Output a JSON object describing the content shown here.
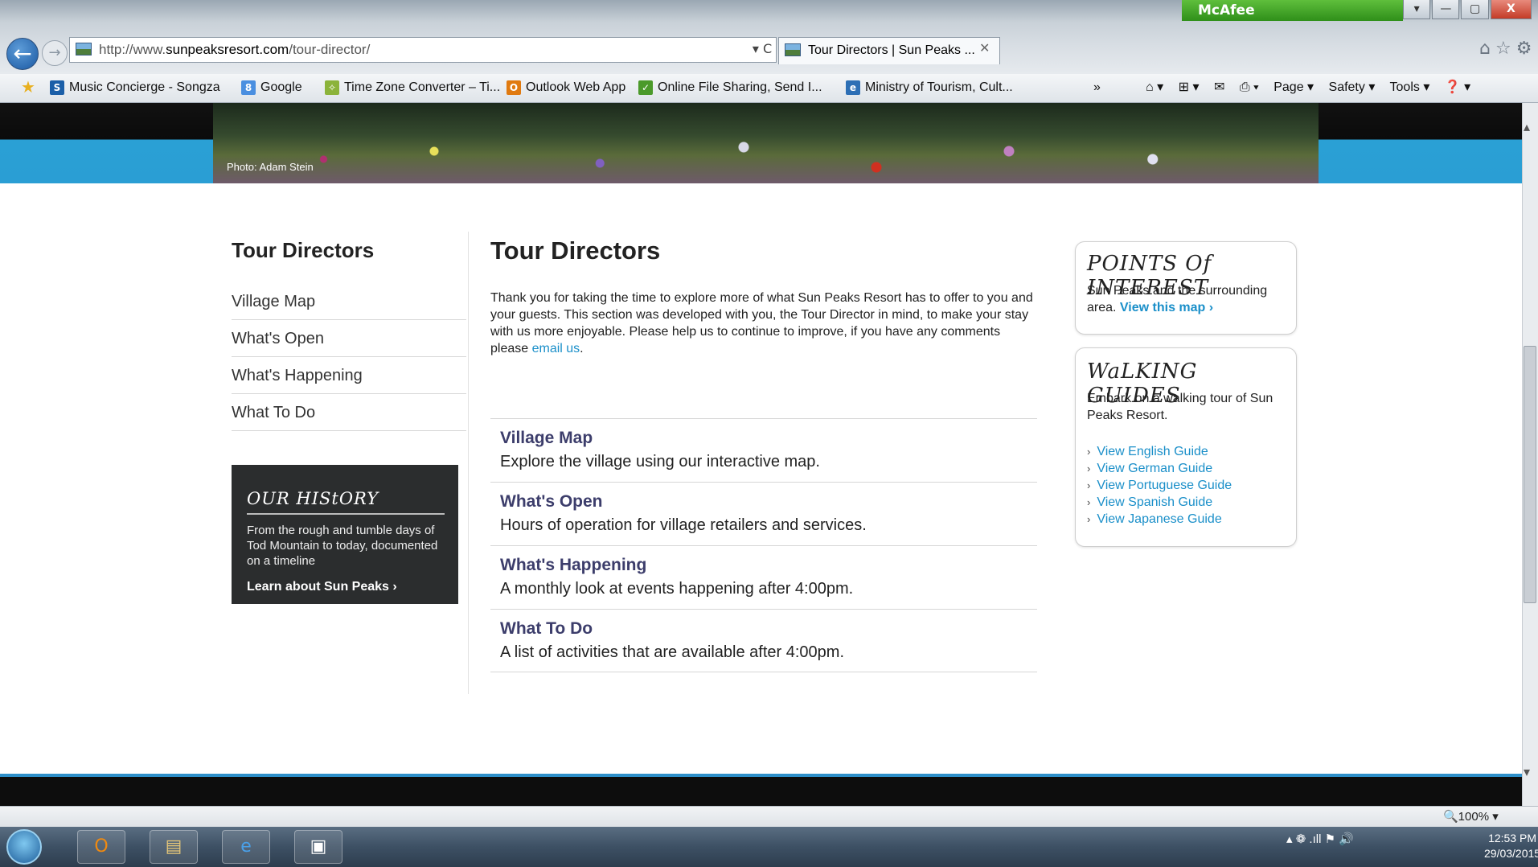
{
  "browser": {
    "mcafee": "McAfee",
    "window_controls": [
      "▾",
      "—",
      "▢",
      "X"
    ],
    "address_prefix": "http://www.",
    "address_host": "sunpeaksresort.com",
    "address_path": "/tour-director/",
    "address_tools": "▾ C",
    "tab_title": "Tour Directors | Sun Peaks ...",
    "tab_close": "✕",
    "top_icons": "⌂☆⚙"
  },
  "favorites": [
    {
      "icon": "S",
      "label": "Music Concierge - Songza",
      "color": "#1b5fa8"
    },
    {
      "icon": "8",
      "label": "Google",
      "color": "#4a8fe0"
    },
    {
      "icon": "✧",
      "label": "Time Zone Converter – Ti...",
      "color": "#8bb33a"
    },
    {
      "icon": "O",
      "label": "Outlook Web App",
      "color": "#e07a10"
    },
    {
      "icon": "✓",
      "label": "Online File Sharing, Send I...",
      "color": "#4b9a2a"
    },
    {
      "icon": "e",
      "label": "Ministry of Tourism, Cult...",
      "color": "#2d6fb5"
    }
  ],
  "favorites_more": "»",
  "commandbar": {
    "home": "⌂ ▾",
    "feeds": "⊞ ▾",
    "mail": "✉",
    "print": "⎙ ▾",
    "page": "Page ▾",
    "safety": "Safety ▾",
    "tools": "Tools ▾",
    "help": "❓ ▾"
  },
  "hero": {
    "credit": "Photo: Adam Stein"
  },
  "sidebar": {
    "title": "Tour Directors",
    "items": [
      {
        "label": "Village Map"
      },
      {
        "label": "What's Open"
      },
      {
        "label": "What's Happening"
      },
      {
        "label": "What To Do"
      }
    ]
  },
  "history": {
    "title": "OUR HIStORY",
    "text": "From the rough and tumble days of Tod Mountain to today, documented on a timeline",
    "link": "Learn about Sun Peaks ›"
  },
  "main": {
    "title": "Tour Directors",
    "intro": "Thank you for taking the time to explore more of what Sun Peaks Resort has to offer to you and your guests. This section was developed with you, the Tour Director in mind, to make your stay with us more enjoyable. Please help us to continue to improve, if you have any comments please ",
    "intro_link": "email us",
    "intro_end": ".",
    "entries": [
      {
        "heading": "Village Map",
        "desc": "Explore the village using our interactive map."
      },
      {
        "heading": "What's Open",
        "desc": "Hours of operation for village retailers and services."
      },
      {
        "heading": "What's Happening",
        "desc": "A monthly look at events happening after 4:00pm."
      },
      {
        "heading": "What To Do",
        "desc": "A list of activities that are available after 4:00pm."
      }
    ]
  },
  "poi": {
    "title": "POINTS Of INTEREST",
    "text": "Sun Peaks and the surrounding area. ",
    "link": "View this map ›"
  },
  "walking": {
    "title": "WaLKING GUIDES",
    "text": "Embark on a walking tour of Sun Peaks Resort.",
    "guides": [
      "View English Guide",
      "View German Guide",
      "View Portuguese Guide",
      "View Spanish Guide",
      "View Japanese Guide"
    ]
  },
  "status": {
    "zoom": "🔍100% ▾"
  },
  "taskbar": {
    "time": "12:53 PM",
    "date": "29/03/2015",
    "tray": "▴ ❁ .ıll ⚑ 🔊"
  }
}
